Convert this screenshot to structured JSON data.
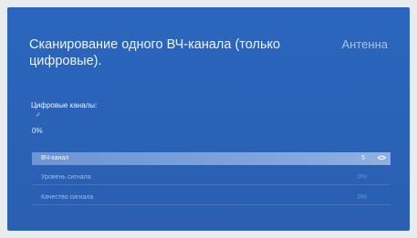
{
  "header": {
    "title": "Сканирование одного ВЧ-канала (только цифровые).",
    "source": "Антенна"
  },
  "section": {
    "label": "Цифровые каналы:",
    "marker": "✓"
  },
  "progress": {
    "label": "0%",
    "value": 0
  },
  "rows": [
    {
      "label": "ВЧ-канал",
      "value": "5",
      "selected": true
    },
    {
      "label": "Уровень сигнала",
      "value": "0%",
      "selected": false
    },
    {
      "label": "Качество сигнала",
      "value": "0%",
      "selected": false
    }
  ],
  "controls": {
    "arrows": "<>"
  },
  "colors": {
    "background": "#2a62b6",
    "highlight": "#7ea3dc",
    "text": "#eef3fb",
    "muted": "#9fbbe3"
  }
}
